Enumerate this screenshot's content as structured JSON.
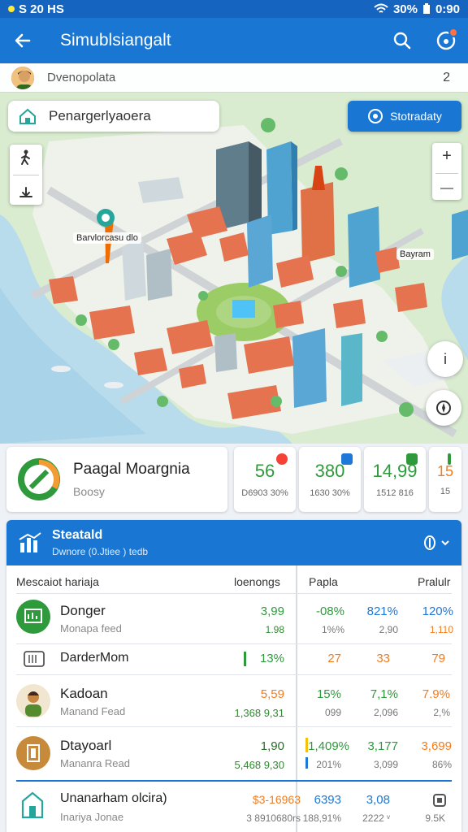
{
  "status_bar": {
    "time": "S 20 HS",
    "right": "30%",
    "battery": "0:90"
  },
  "app_bar": {
    "title": "Simublsiangalt",
    "back_icon": "arrow-left-icon",
    "search_icon": "search-icon",
    "notification_icon": "bell-icon"
  },
  "user": {
    "name": "Dvenopolata",
    "count": "2"
  },
  "search": {
    "placeholder": "Penargerlyaoera"
  },
  "action_button": {
    "label": "Stotradaty"
  },
  "map": {
    "labels": {
      "landmark": "Barvlorcasu dlo",
      "district": "Bayram"
    },
    "controls": {
      "zoom_in": "+",
      "zoom_out": "—",
      "info": "i"
    }
  },
  "profile": {
    "title": "Paagal Moargnia",
    "subtitle": "Boosy"
  },
  "mini_stats": [
    {
      "value": "56",
      "sub": "D6903 30%",
      "color": "#2e9a3c",
      "badge": "#f44336"
    },
    {
      "value": "380",
      "sub": "1630 30%",
      "color": "#2e9a3c",
      "badge": "#1e78d8"
    },
    {
      "value": "14,99",
      "sub": "1512 816",
      "color": "#2e9a3c",
      "badge": "#2e9a3c"
    },
    {
      "value": "15",
      "sub": "15",
      "color": "#ef7d22",
      "badge": "#2e9a3c"
    }
  ],
  "panel": {
    "title": "Steatald",
    "subtitle": "Dwnore (0.Jtiee ) tedb",
    "columns": {
      "name": "Mescaiot hariaja",
      "left": "loenongs",
      "mid": "Papla",
      "right": "Pralulr"
    },
    "rows": [
      {
        "title": "Donger",
        "sub": "Monapa feed",
        "val": "3,99",
        "val_sub": "1.98",
        "c1": "-08%",
        "c1_sub": "1%%",
        "c2": "821%",
        "c2_sub": "2,90",
        "c3": "120%",
        "c3_sub": "1,110"
      },
      {
        "title": "DarderMom",
        "sub": "",
        "val": "13%",
        "val_sub": "",
        "c1": "27",
        "c1_sub": "",
        "c2": "33",
        "c2_sub": "",
        "c3": "79",
        "c3_sub": ""
      },
      {
        "title": "Kadoan",
        "sub": "Manand Fead",
        "val": "5,59",
        "val_sub": "1,368 9,31",
        "c1": "15%",
        "c1_sub": "099",
        "c2": "7,1%",
        "c2_sub": "2,096",
        "c3": "7.9%",
        "c3_sub": "2,%"
      },
      {
        "title": "Dtayoarl",
        "sub": "Mananra Read",
        "val": "1,90",
        "val_sub": "5,468 9,30",
        "c1": "1,409%",
        "c1_sub": "201%",
        "c2": "3,177",
        "c2_sub": "3,099",
        "c3": "3,699",
        "c3_sub": "86%"
      },
      {
        "title": "Unanarham olcira)",
        "sub": "Inariya Jonae",
        "val": "$3-16963",
        "val_sub": "3 8910680rs",
        "c1": "6393",
        "c1_sub": "188,91%",
        "c2": "3,08",
        "c2_sub": "2222 ᵛ",
        "c3": "",
        "c3_sub": "9.5K"
      }
    ]
  }
}
